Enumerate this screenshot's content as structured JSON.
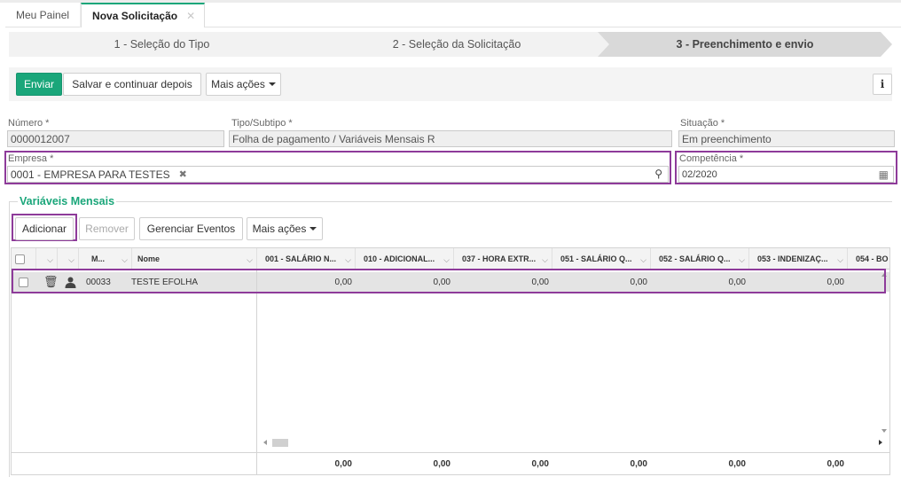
{
  "tabs": [
    {
      "label": "Meu Painel"
    },
    {
      "label": "Nova Solicitação"
    }
  ],
  "steps": [
    {
      "label": "1 - Seleção do Tipo"
    },
    {
      "label": "2 - Seleção da Solicitação"
    },
    {
      "label": "3 - Preenchimento e envio"
    }
  ],
  "actions": {
    "send": "Enviar",
    "save_continue": "Salvar e continuar depois",
    "more": "Mais ações",
    "info": "i"
  },
  "fields": {
    "numero": {
      "label": "Número *",
      "value": "0000012007"
    },
    "tipo": {
      "label": "Tipo/Subtipo *",
      "value": "Folha de pagamento / Variáveis Mensais R"
    },
    "situacao": {
      "label": "Situação *",
      "value": "Em preenchimento"
    },
    "empresa": {
      "label": "Empresa *",
      "value": "0001 - EMPRESA PARA TESTES"
    },
    "competencia": {
      "label": "Competência *",
      "value": "02/2020"
    }
  },
  "section": {
    "title": "Variáveis Mensais",
    "add": "Adicionar",
    "remove": "Remover",
    "manage": "Gerenciar Eventos",
    "more": "Mais ações"
  },
  "grid": {
    "headers": {
      "m": "M...",
      "nome": "Nome",
      "cols": [
        "001 - SALÁRIO N...",
        "010 - ADICIONAL...",
        "037 - HORA EXTR...",
        "051 - SALÁRIO Q...",
        "052 - SALÁRIO Q...",
        "053 - INDENIZAÇ...",
        "054 - BO"
      ]
    },
    "rows": [
      {
        "matricula": "00033",
        "nome": "TESTE EFOLHA",
        "values": [
          "0,00",
          "0,00",
          "0,00",
          "0,00",
          "0,00",
          "0,00"
        ]
      }
    ],
    "totals": [
      "0,00",
      "0,00",
      "0,00",
      "0,00",
      "0,00",
      "0,00"
    ]
  },
  "colors": {
    "accent": "#1aa67a",
    "highlight": "#8e3b9a"
  }
}
